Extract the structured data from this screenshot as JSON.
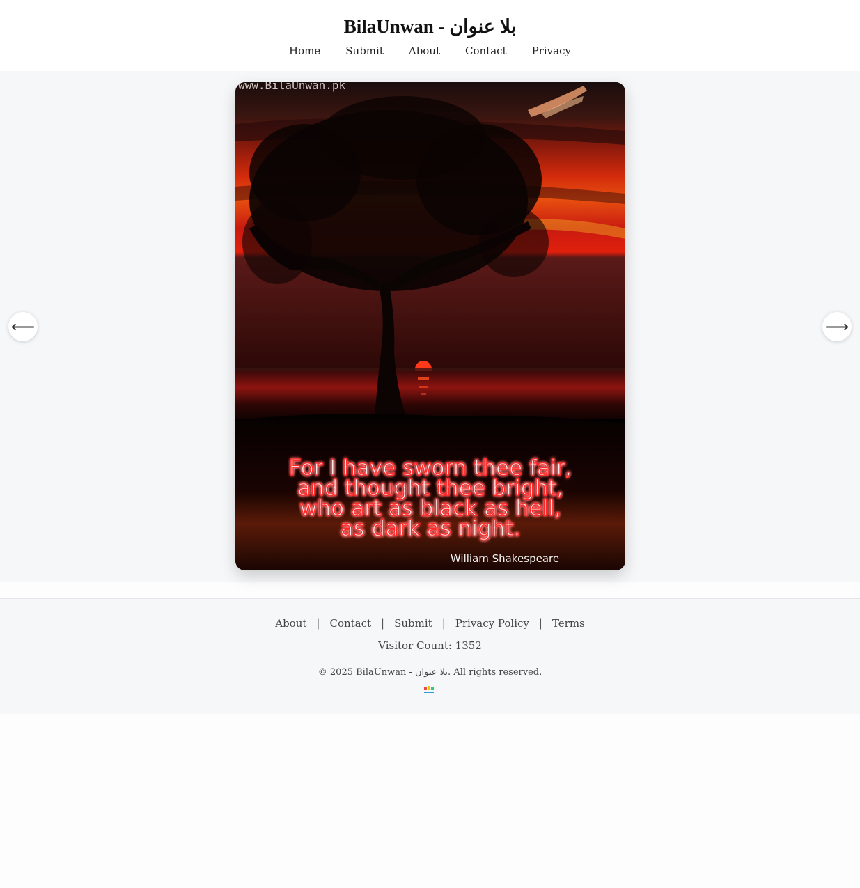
{
  "header": {
    "title": "BilaUnwan - بلا عنوان",
    "nav": [
      "Home",
      "Submit",
      "About",
      "Contact",
      "Privacy"
    ]
  },
  "carousel": {
    "prev_arrow": "⟵",
    "next_arrow": "⟶",
    "image": {
      "watermark": "www.BilaUnwan.pk",
      "quote_lines": [
        "For I have sworn thee fair,",
        "and thought thee bright,",
        "who art as black as hell,",
        "as dark as night."
      ],
      "author": "William Shakespeare"
    }
  },
  "footer": {
    "links": [
      "About",
      "Contact",
      "Submit",
      "Privacy Policy",
      "Terms"
    ],
    "separator": "|",
    "visitor_count": "Visitor Count: 1352",
    "copyright": "© 2025 BilaUnwan - بلا عنوان. All rights reserved."
  },
  "colors": {
    "stage_bg": "#f6f7f9",
    "quote_glow": "#ff2a2a",
    "sun": "#ff3a1a"
  }
}
